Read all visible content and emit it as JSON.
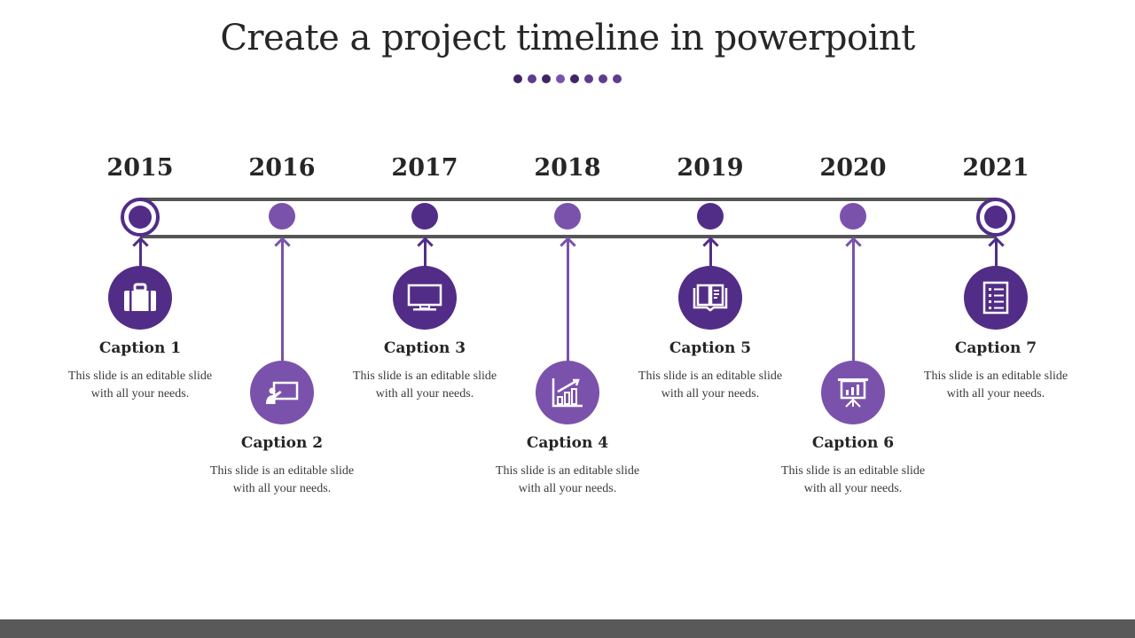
{
  "title": "Create a project timeline in powerpoint",
  "colors": {
    "dark": "#522D87",
    "light": "#7B52AB",
    "track": "#555555",
    "footer": "#595959"
  },
  "dots": [
    "#3F2466",
    "#5E3C8E",
    "#3F2466",
    "#7B52AB",
    "#3F2466",
    "#5E3C8E",
    "#5E3C8E",
    "#5E3C8E"
  ],
  "milestones": [
    {
      "year": "2015",
      "caption": "Caption 1",
      "text": "This slide is an editable slide with all your needs.",
      "icon": "briefcase-icon",
      "tone": "dark",
      "position": "upper",
      "end": true
    },
    {
      "year": "2016",
      "caption": "Caption 2",
      "text": "This slide is an editable slide with all your needs.",
      "icon": "presentation-teacher-icon",
      "tone": "light",
      "position": "lower"
    },
    {
      "year": "2017",
      "caption": "Caption 3",
      "text": "This slide is an editable slide with all your needs.",
      "icon": "monitor-icon",
      "tone": "dark",
      "position": "upper"
    },
    {
      "year": "2018",
      "caption": "Caption 4",
      "text": "This slide is an editable slide with all your needs.",
      "icon": "growth-chart-icon",
      "tone": "light",
      "position": "lower"
    },
    {
      "year": "2019",
      "caption": "Caption 5",
      "text": "This slide is an editable slide with all your needs.",
      "icon": "open-book-icon",
      "tone": "dark",
      "position": "upper"
    },
    {
      "year": "2020",
      "caption": "Caption 6",
      "text": "This slide is an editable slide with all your needs.",
      "icon": "projector-chart-icon",
      "tone": "light",
      "position": "lower"
    },
    {
      "year": "2021",
      "caption": "Caption 7",
      "text": "This slide is an editable slide with all your needs.",
      "icon": "checklist-icon",
      "tone": "dark",
      "position": "upper",
      "end": true
    }
  ]
}
